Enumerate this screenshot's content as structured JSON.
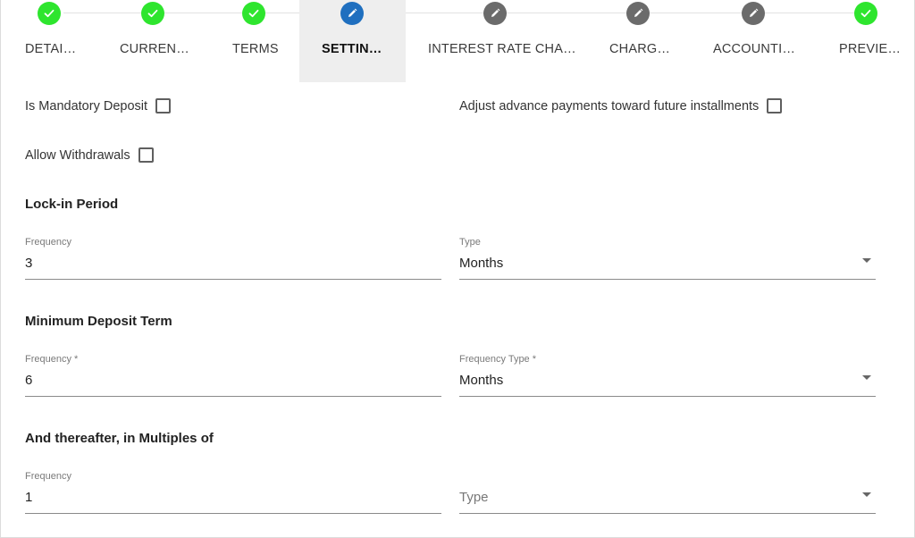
{
  "stepper": {
    "steps": [
      {
        "label": "DETAI…",
        "state": "complete",
        "icon": "check-icon"
      },
      {
        "label": "CURREN…",
        "state": "complete",
        "icon": "check-icon"
      },
      {
        "label": "TERMS",
        "state": "complete",
        "icon": "check-icon"
      },
      {
        "label": "SETTIN…",
        "state": "active",
        "icon": "pencil-icon"
      },
      {
        "label": "INTEREST RATE CHA…",
        "state": "editable",
        "icon": "pencil-icon"
      },
      {
        "label": "CHARG…",
        "state": "editable",
        "icon": "pencil-icon"
      },
      {
        "label": "ACCOUNTI…",
        "state": "editable",
        "icon": "pencil-icon"
      },
      {
        "label": "PREVIE…",
        "state": "complete",
        "icon": "check-icon"
      }
    ],
    "colors": {
      "complete": "#2ee52e",
      "active": "#1f6fbf",
      "editable": "#6b6b6b"
    }
  },
  "checkboxes": {
    "mandatory_deposit": {
      "label": "Is Mandatory Deposit",
      "checked": false
    },
    "adjust_advance": {
      "label": "Adjust advance payments toward future installments",
      "checked": false
    },
    "allow_withdrawals": {
      "label": "Allow Withdrawals",
      "checked": false
    }
  },
  "lock_in": {
    "title": "Lock-in Period",
    "frequency": {
      "label": "Frequency",
      "value": "3"
    },
    "type": {
      "label": "Type",
      "value": "Months"
    }
  },
  "minimum_term": {
    "title": "Minimum Deposit Term",
    "frequency": {
      "label": "Frequency *",
      "value": "6"
    },
    "type": {
      "label": "Frequency Type *",
      "value": "Months"
    }
  },
  "multiples": {
    "title": "And thereafter, in Multiples of",
    "frequency": {
      "label": "Frequency",
      "value": "1"
    },
    "type": {
      "placeholder": "Type"
    }
  }
}
